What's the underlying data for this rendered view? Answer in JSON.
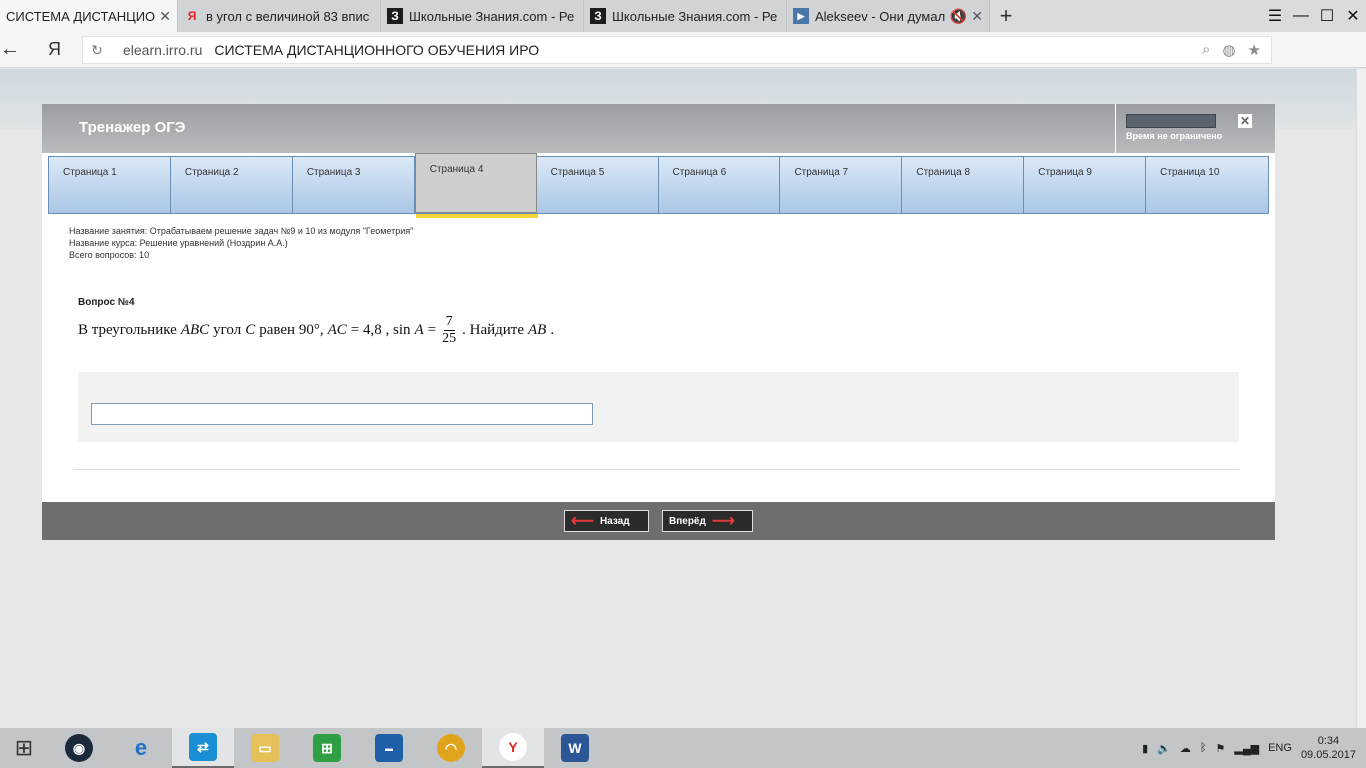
{
  "browser": {
    "tabs": [
      {
        "title": "СИСТЕМА ДИСТАНЦИОН",
        "icon": "page-icon",
        "active": true
      },
      {
        "title": "в угол с величиной 83 впис",
        "icon": "yandex-icon",
        "favicon": "Я"
      },
      {
        "title": "Школьные Знания.com - Ре",
        "icon": "znania-icon",
        "favicon": "З"
      },
      {
        "title": "Школьные Знания.com - Ре",
        "icon": "znania-icon",
        "favicon": "З"
      },
      {
        "title": "Alekseev - Они думал",
        "icon": "video-icon",
        "favicon": "▶"
      }
    ],
    "new_tab": "+",
    "address": {
      "host": "elearn.irro.ru",
      "page_title": "СИСТЕМА ДИСТАНЦИОННОГО ОБУЧЕНИЯ ИРО"
    }
  },
  "app": {
    "title": "Тренажер ОГЭ",
    "timer_text": "Время не ограничено",
    "close": "✕",
    "pages": [
      "Страница 1",
      "Страница 2",
      "Страница 3",
      "Страница 4",
      "Страница 5",
      "Страница 6",
      "Страница 7",
      "Страница 8",
      "Страница 9",
      "Страница 10"
    ],
    "active_page": 3,
    "info": {
      "lesson": "Название занятия: Отрабатываем решение задач №9 и 10 из модуля \"Геометрия\"",
      "course": "Название курса: Решение уравнений (Ноздрин А.А.)",
      "total": "Всего вопросов: 10"
    },
    "question": {
      "heading": "Вопрос №4",
      "t1": "В треугольнике",
      "abc": "ABC",
      "t2": "угол",
      "c": "C",
      "t3": "равен 90°,",
      "ac": "AC",
      "t4": "= 4,8 ,  sin",
      "a": "A",
      "t5": "=",
      "num": "7",
      "den": "25",
      "t6": ". Найдите",
      "ab": "AB",
      "t7": "."
    },
    "answer_value": "",
    "buttons": {
      "back": "Назад",
      "forward": "Вперёд"
    }
  },
  "taskbar": {
    "lang": "ENG",
    "time": "0:34",
    "date": "09.05.2017"
  },
  "colors": {
    "accent_yellow": "#f5d33a",
    "nav_red": "#e03a3a"
  }
}
